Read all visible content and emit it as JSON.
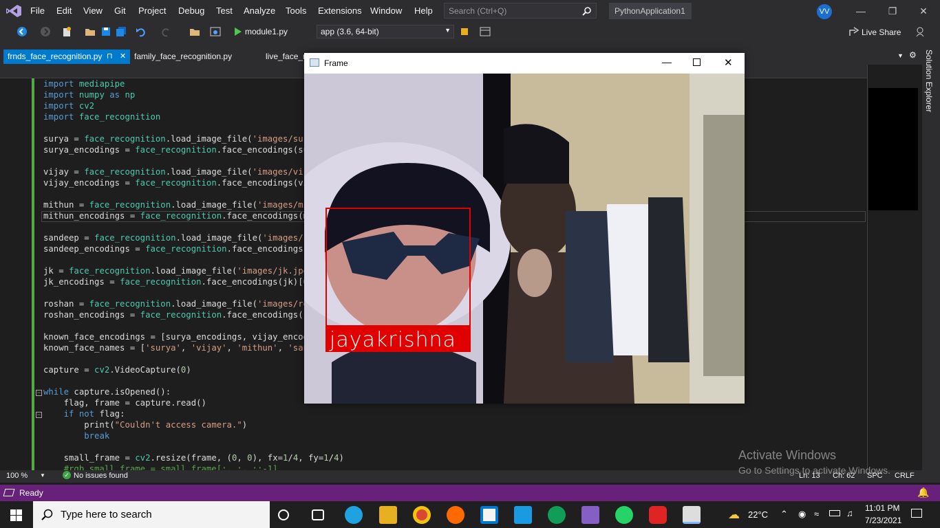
{
  "menu": [
    "File",
    "Edit",
    "View",
    "Git",
    "Project",
    "Debug",
    "Test",
    "Analyze",
    "Tools",
    "Extensions",
    "Window",
    "Help"
  ],
  "search": {
    "placeholder": "Search (Ctrl+Q)"
  },
  "solution_name": "PythonApplication1",
  "user_initials": "VV",
  "toolbar": {
    "startup_item": "module1.py",
    "environment": "app (3.6, 64-bit)",
    "live_share": "Live Share"
  },
  "tabs": [
    {
      "label": "frnds_face_recognition.py",
      "active": true,
      "pin_glyph": "⊓",
      "close_glyph": "✕"
    },
    {
      "label": "family_face_recognition.py",
      "active": false
    },
    {
      "label": "live_face_r",
      "active": false
    }
  ],
  "code": [
    {
      "line": "import mediapipe"
    },
    {
      "line": "import numpy as np"
    },
    {
      "line": "import cv2"
    },
    {
      "line": "import face_recognition"
    },
    {
      "line": ""
    },
    {
      "line": "surya = face_recognition.load_image_file('images/surya"
    },
    {
      "line": "surya_encodings = face_recognition.face_encodings(sury"
    },
    {
      "line": ""
    },
    {
      "line": "vijay = face_recognition.load_image_file('images/vijay"
    },
    {
      "line": "vijay_encodings = face_recognition.face_encodings(vija"
    },
    {
      "line": ""
    },
    {
      "line": "mithun = face_recognition.load_image_file('images/mith"
    },
    {
      "line": "mithun_encodings = face_recognition.face_encodings(mit"
    },
    {
      "line": ""
    },
    {
      "line": "sandeep = face_recognition.load_image_file('images/san"
    },
    {
      "line": "sandeep_encodings = face_recognition.face_encodings(sa"
    },
    {
      "line": ""
    },
    {
      "line": "jk = face_recognition.load_image_file('images/jk.jpeg'"
    },
    {
      "line": "jk_encodings = face_recognition.face_encodings(jk)[0]"
    },
    {
      "line": ""
    },
    {
      "line": "roshan = face_recognition.load_image_file('images/rosh"
    },
    {
      "line": "roshan_encodings = face_recognition.face_encodings(ros"
    },
    {
      "line": ""
    },
    {
      "line": "known_face_encodings = [surya_encodings, vijay_encodin"
    },
    {
      "line": "known_face_names = ['surya', 'vijay', 'mithun', 'sande"
    },
    {
      "line": ""
    },
    {
      "line": "capture = cv2.VideoCapture(0)"
    },
    {
      "line": ""
    },
    {
      "line": "while capture.isOpened():"
    },
    {
      "line": "    flag, frame = capture.read()"
    },
    {
      "line": "    if not flag:"
    },
    {
      "line": "        print(\"Couldn't access camera.\")"
    },
    {
      "line": "        break"
    },
    {
      "line": ""
    },
    {
      "line": "    small_frame = cv2.resize(frame, (0, 0), fx=1/4, fy=1/4)"
    },
    {
      "line": "    #rgb_small_frame = small_frame[:, :, ::-1]"
    }
  ],
  "editor_status": {
    "zoom": "100 %",
    "issues": "No issues found",
    "line": "Ln: 13",
    "col": "Ch: 62",
    "spc": "SPC",
    "eol": "CRLF"
  },
  "solution_explorer": "Solution Explorer",
  "statusbar": {
    "text": "Ready"
  },
  "watermark": {
    "line1": "Activate Windows",
    "line2": "Go to Settings to activate Windows."
  },
  "frame_window": {
    "title": "Frame",
    "detected_name": "jayakrishna"
  },
  "taskbar": {
    "search": "Type here to search",
    "weather": "22°C",
    "time": "11:01 PM",
    "date": "7/23/2021"
  },
  "colors": {
    "accent": "#007acc",
    "statusbar": "#68217a",
    "detection_box": "#e00000"
  }
}
